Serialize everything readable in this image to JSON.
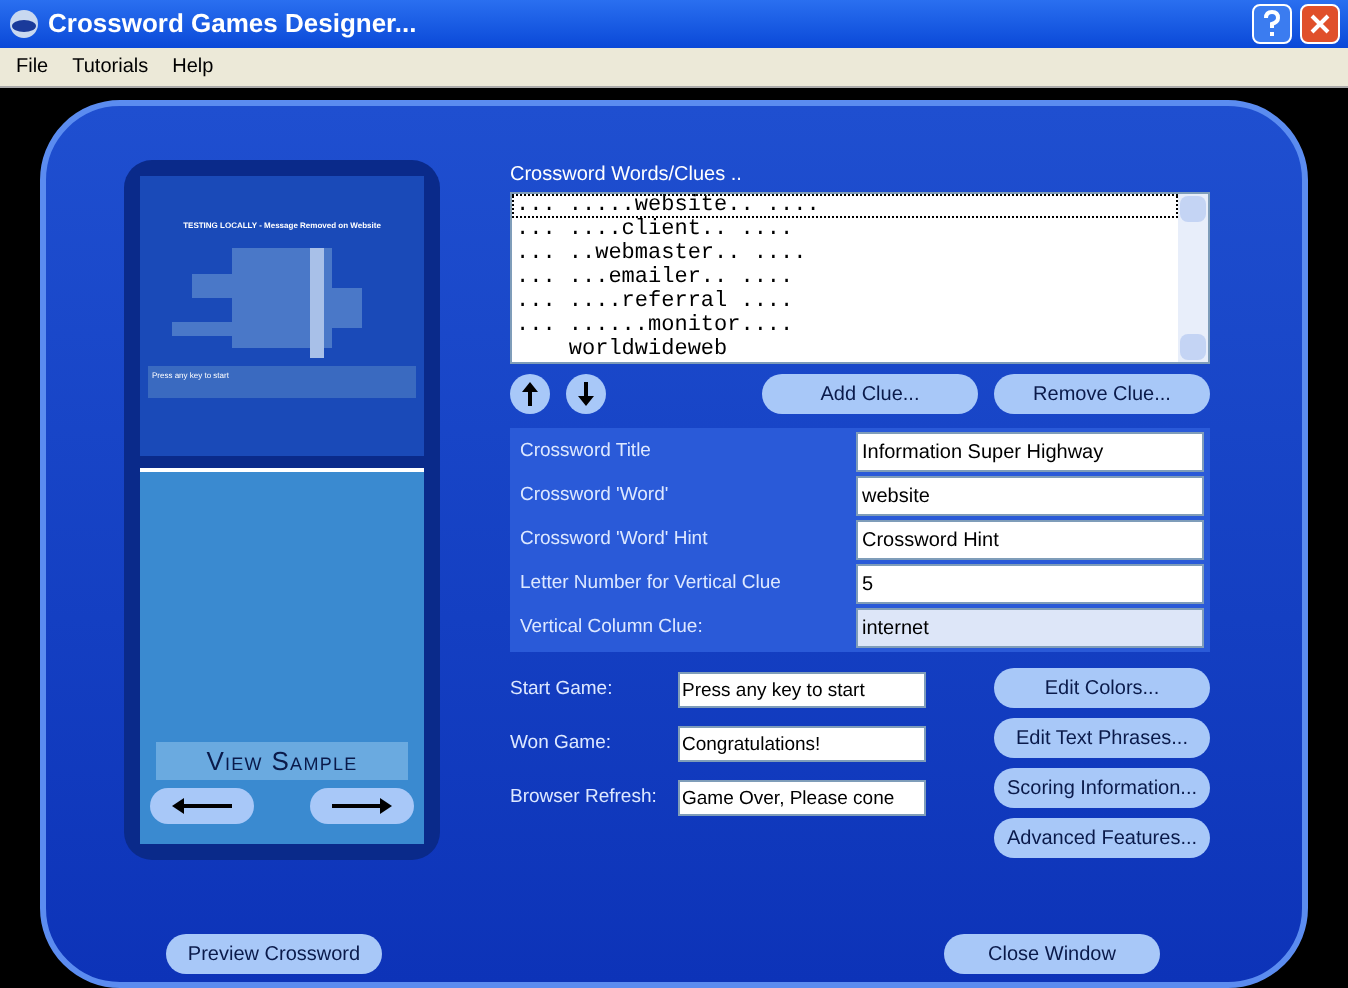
{
  "window": {
    "title": "Crossword Games Designer..."
  },
  "menu": [
    "File",
    "Tutorials",
    "Help"
  ],
  "preview": {
    "heading": "TESTING LOCALLY - Message Removed on Website",
    "status": "Press any key to start",
    "view_label": "View Sample"
  },
  "clues": {
    "label": "Crossword Words/Clues ..",
    "items": [
      {
        "text": "... .....website.. ....",
        "selected": true
      },
      {
        "text": "... ....client.. ....",
        "selected": false
      },
      {
        "text": "... ..webmaster.. ....",
        "selected": false
      },
      {
        "text": "... ...emailer.. ....",
        "selected": false
      },
      {
        "text": "... ....referral ....",
        "selected": false
      },
      {
        "text": "... ......monitor....",
        "selected": false
      },
      {
        "text": "    worldwideweb",
        "selected": false
      }
    ],
    "buttons": [
      "Add Clue...",
      "Remove Clue..."
    ]
  },
  "fields": [
    {
      "label": "Crossword Title",
      "value": "Information Super Highway",
      "disabled": false
    },
    {
      "label": "Crossword 'Word'",
      "value": "website",
      "disabled": false
    },
    {
      "label": "Crossword 'Word' Hint",
      "value": "Crossword Hint",
      "disabled": false
    },
    {
      "label": "Letter Number for Vertical Clue",
      "value": "5",
      "disabled": false
    },
    {
      "label": "Vertical Column Clue:",
      "value": "internet",
      "disabled": true
    }
  ],
  "messages": [
    {
      "label": "Start Game:",
      "value": "Press any key to start"
    },
    {
      "label": "Won Game:",
      "value": "Congratulations!"
    },
    {
      "label": "Browser Refresh:",
      "value": "Game Over, Please cone"
    }
  ],
  "side_buttons": [
    "Edit Colors...",
    "Edit Text Phrases...",
    "Scoring Information...",
    "Advanced Features..."
  ],
  "footer_buttons": [
    "Preview Crossword",
    "Close Window"
  ]
}
